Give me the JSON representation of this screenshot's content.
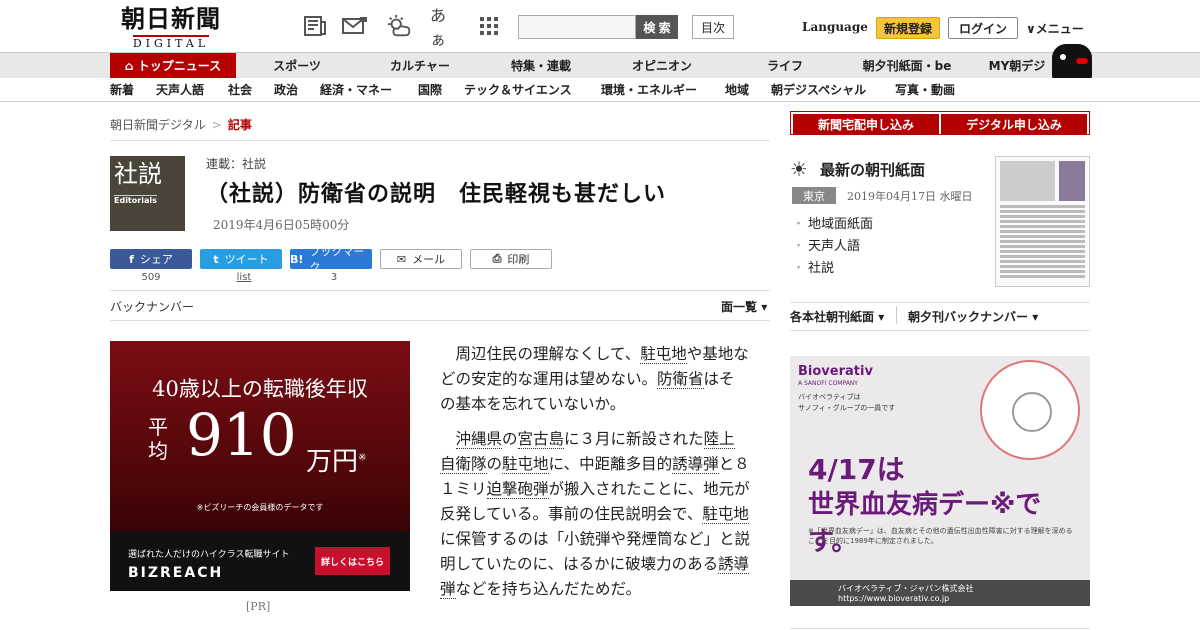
{
  "header": {
    "logo_main": "朝日新聞",
    "logo_sub": "DIGITAL",
    "search_button": "検 索",
    "toc_button": "目次",
    "language": "Language",
    "signup": "新規登録",
    "login": "ログイン",
    "menu": "メニュー",
    "icons": [
      "newspaper-icon",
      "mail-icon",
      "weather-icon",
      "font-size-icon",
      "grid-menu-icon"
    ],
    "font_icon_text": "あぁ"
  },
  "nav_primary": [
    "トップニュース",
    "スポーツ",
    "カルチャー",
    "特集・連載",
    "オピニオン",
    "ライフ",
    "朝夕刊紙面・be",
    "MY朝デジ"
  ],
  "nav_secondary": [
    "新着",
    "天声人語",
    "社会",
    "政治",
    "経済・マネー",
    "国際",
    "テック＆サイエンス",
    "環境・エネルギー",
    "地域",
    "朝デジスペシャル",
    "写真・動画"
  ],
  "breadcrumb": {
    "home": "朝日新聞デジタル",
    "sep": ">",
    "current": "記事"
  },
  "article": {
    "thumb_kanji": "社説",
    "thumb_en": "Editorials",
    "series": "連載：社説",
    "title": "（社説）防衛省の説明　住民軽視も甚だしい",
    "date": "2019年4月6日05時00分",
    "share": [
      {
        "icon": "f",
        "label": "シェア",
        "count": "509"
      },
      {
        "icon": "t",
        "label": "ツイート",
        "count": "list"
      },
      {
        "icon": "B!",
        "label": "ブックマーク",
        "count": "3"
      },
      {
        "icon": "✉",
        "label": "メール",
        "count": ""
      },
      {
        "icon": "⎙",
        "label": "印刷",
        "count": ""
      }
    ],
    "back_numbers": "バックナンバー",
    "view_list": "面一覧",
    "paragraphs": [
      [
        "周辺住民の理解なくして、",
        {
          "u": "駐屯地"
        },
        "や基地などの安定的な運用は望めない。",
        {
          "u": "防衛省"
        },
        "はその基本を忘れていないか。"
      ],
      [
        {
          "u": "沖縄県"
        },
        "の",
        {
          "u": "宮古島"
        },
        "に３月に新設された",
        {
          "u": "陸上自衛隊"
        },
        "の",
        {
          "u": "駐屯地"
        },
        "に、中距離多目的",
        {
          "u": "誘導弾"
        },
        "と８１ミリ",
        {
          "u": "迫撃砲弾"
        },
        "が搬入されたことに、地元が反発している。事前の住民説明会で、",
        {
          "u": "駐屯地"
        },
        "に保管するのは「小銃弾や発煙筒など」と説明していたのに、はるかに破壊力のある",
        {
          "u": "誘導弾"
        },
        "などを持ち込んだためだ。"
      ]
    ]
  },
  "ad_left": {
    "line1": "40歳以上の転職後年収",
    "avg": "平均",
    "amount": "910",
    "unit": "万円",
    "mark": "※",
    "note": "※ビズリーチの会員様のデータです",
    "bottom_line": "選ばれた人だけのハイクラス転職サイト",
    "brand": "BIZREACH",
    "cta": "詳しくはこちら",
    "pr": "[PR]"
  },
  "right": {
    "tab_delivery": "新聞宅配申し込み",
    "tab_digital": "デジタル申し込み",
    "latest_title": "最新の朝刊紙面",
    "region": "東京",
    "date": "2019年04月17日 水曜日",
    "links": [
      "地域面紙面",
      "天声人語",
      "社説"
    ],
    "select_branch": "各本社朝刊紙面",
    "select_back": "朝夕刊バックナンバー"
  },
  "ad_right": {
    "brand": "Bioverativ",
    "brand_sub": "A SANOFI COMPANY",
    "intro1": "バイオベラティブは",
    "intro2": "サノフィ・グループの一員です",
    "date": "4/17は",
    "main": "世界血友病デー※です。",
    "small": "※「世界血友病デー」は、血友病とその他の遺伝性出血性障害に対する理解を深めることを目的に1989年に制定されました。",
    "footer": "バイオベラティブ・ジャパン株式会社　https://www.bioverativ.co.jp"
  }
}
